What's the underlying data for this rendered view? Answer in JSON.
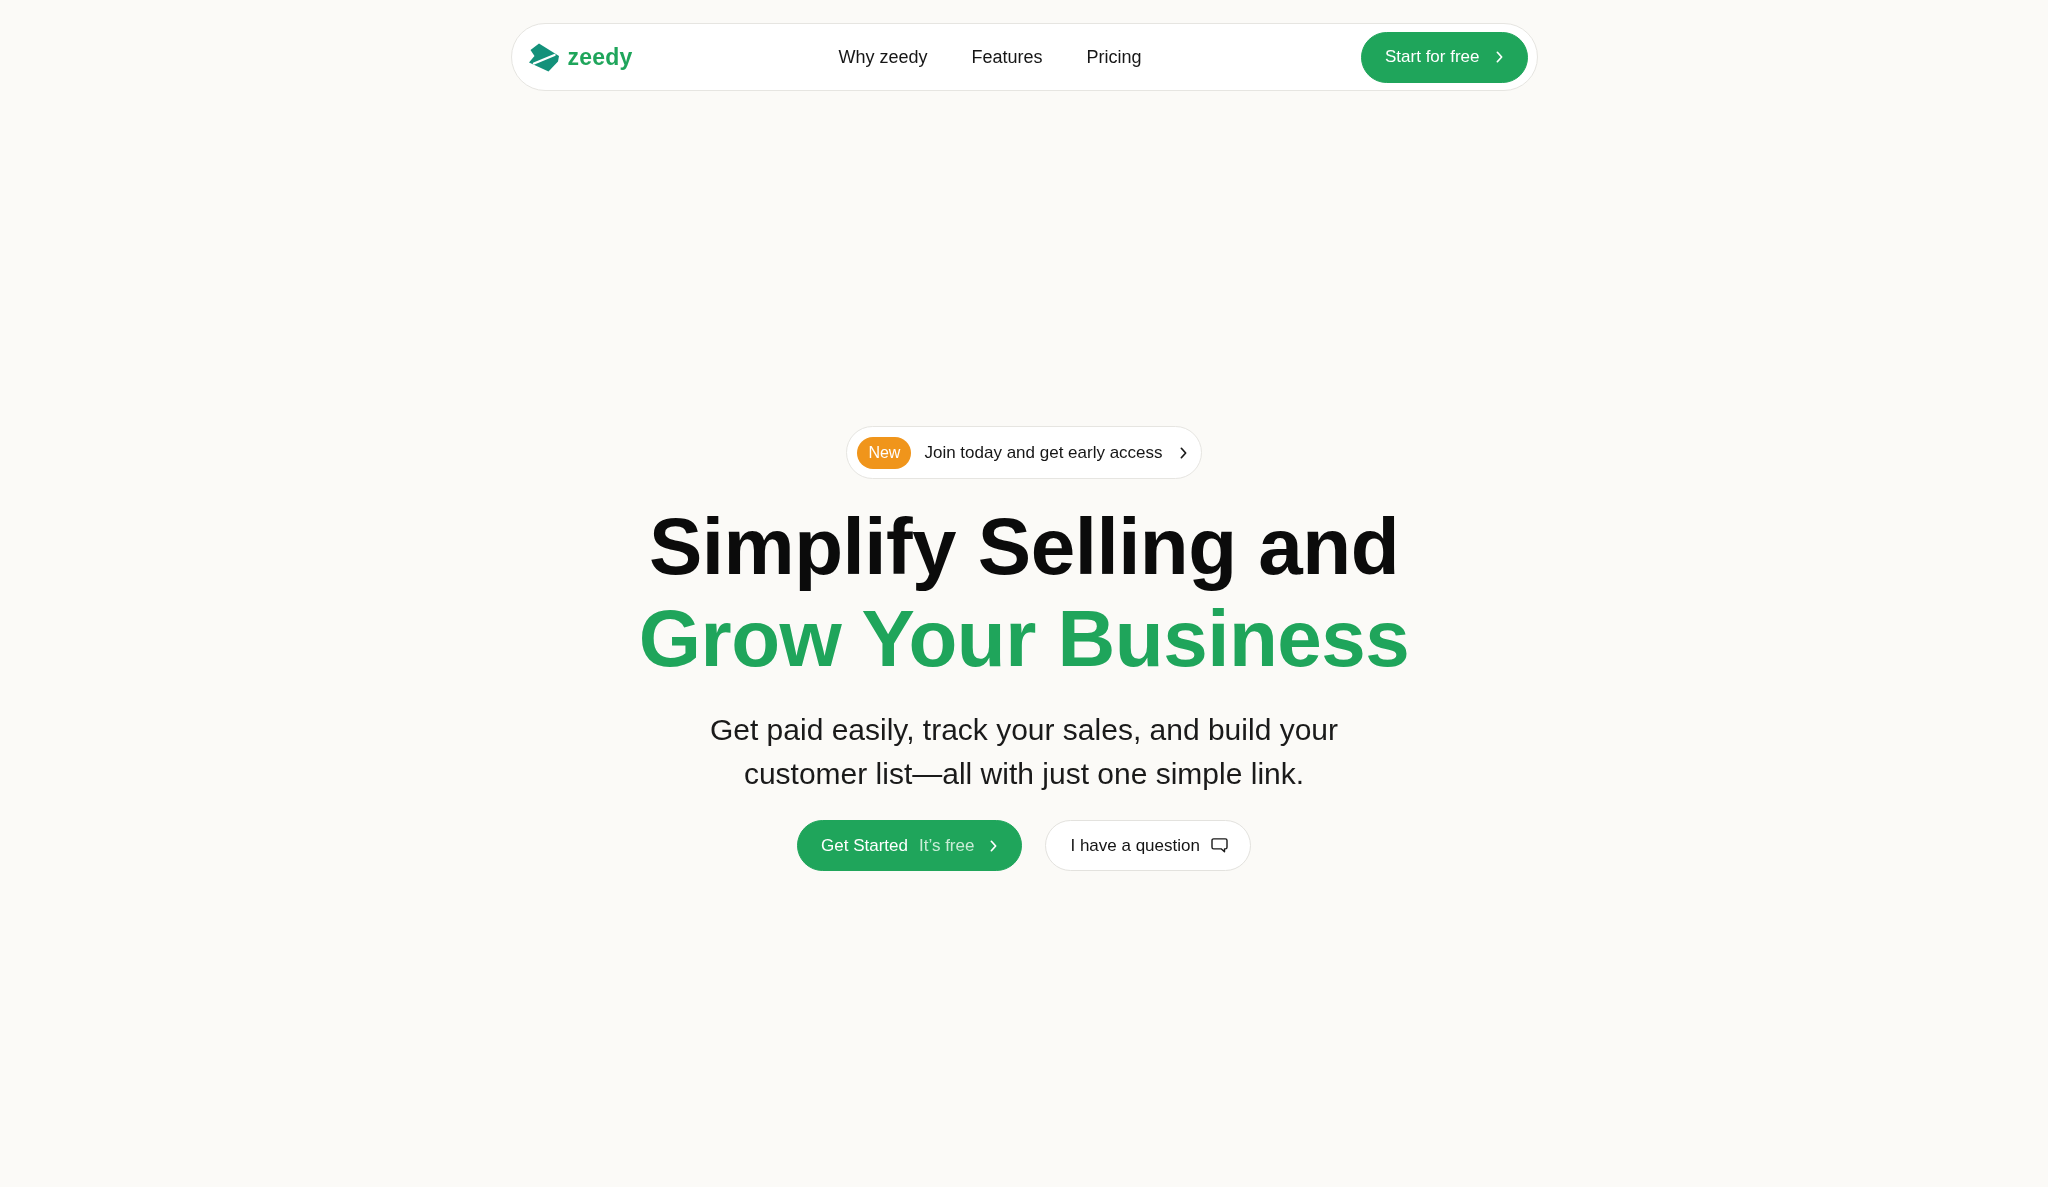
{
  "nav": {
    "brand": "zeedy",
    "links": [
      {
        "label": "Why zeedy"
      },
      {
        "label": "Features"
      },
      {
        "label": "Pricing"
      }
    ],
    "cta": {
      "label": "Start for free"
    }
  },
  "announcement": {
    "badge": "New",
    "text": "Join today and get early access"
  },
  "hero": {
    "title_lines": [
      {
        "text": "Simplify Selling and",
        "kind": "plain"
      },
      {
        "text": "Grow Your Business",
        "kind": "accent"
      }
    ],
    "subtitle": "Get paid easily, track your sales, and build your customer list—all with just one simple link."
  },
  "actions": [
    {
      "kind": "primary",
      "label": "Get Started",
      "note": "It’s free"
    },
    {
      "kind": "secondary",
      "label": "I have a question"
    }
  ]
}
